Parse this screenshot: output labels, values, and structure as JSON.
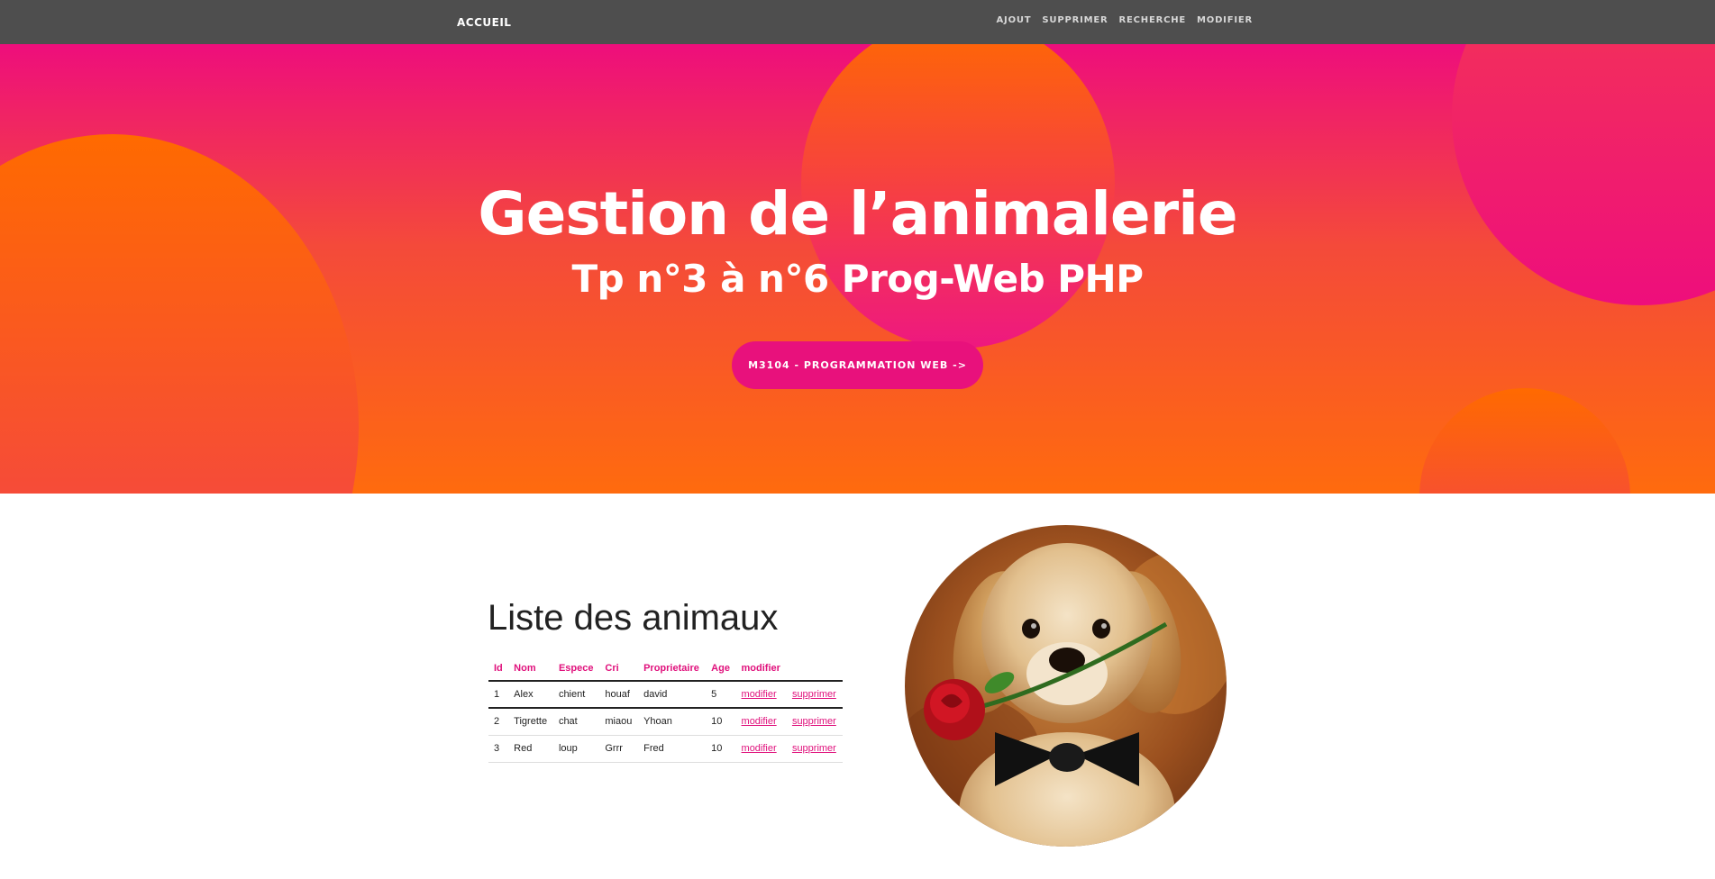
{
  "navbar": {
    "brand": "ACCUEIL",
    "links": [
      "AJOUT",
      "SUPPRIMER",
      "RECHERCHE",
      "MODIFIER"
    ]
  },
  "hero": {
    "title": "Gestion de l’animalerie",
    "subtitle": "Tp n°3 à n°6 Prog-Web PHP",
    "button_label": "M3104 - PROGRAMMATION WEB ->"
  },
  "content": {
    "list_title": "Liste des animaux",
    "columns": [
      "Id",
      "Nom",
      "Espece",
      "Cri",
      "Proprietaire",
      "Age",
      "modifier",
      ""
    ],
    "rows": [
      {
        "id": "1",
        "nom": "Alex",
        "espece": "chient",
        "cri": "houaf",
        "proprietaire": "david",
        "age": "5",
        "modifier": "modifier",
        "supprimer": "supprimer"
      },
      {
        "id": "2",
        "nom": "Tigrette",
        "espece": "chat",
        "cri": "miaou",
        "proprietaire": "Yhoan",
        "age": "10",
        "modifier": "modifier",
        "supprimer": "supprimer"
      },
      {
        "id": "3",
        "nom": "Red",
        "espece": "loup",
        "cri": "Grrr",
        "proprietaire": "Fred",
        "age": "10",
        "modifier": "modifier",
        "supprimer": "supprimer"
      }
    ]
  },
  "colors": {
    "navbar_bg": "#4e4e4e",
    "hero_top": "#ee0e7c",
    "hero_bottom": "#ff6b0e",
    "accent": "#e0117c"
  },
  "icons": {
    "image": "puppy-with-rose-image"
  }
}
